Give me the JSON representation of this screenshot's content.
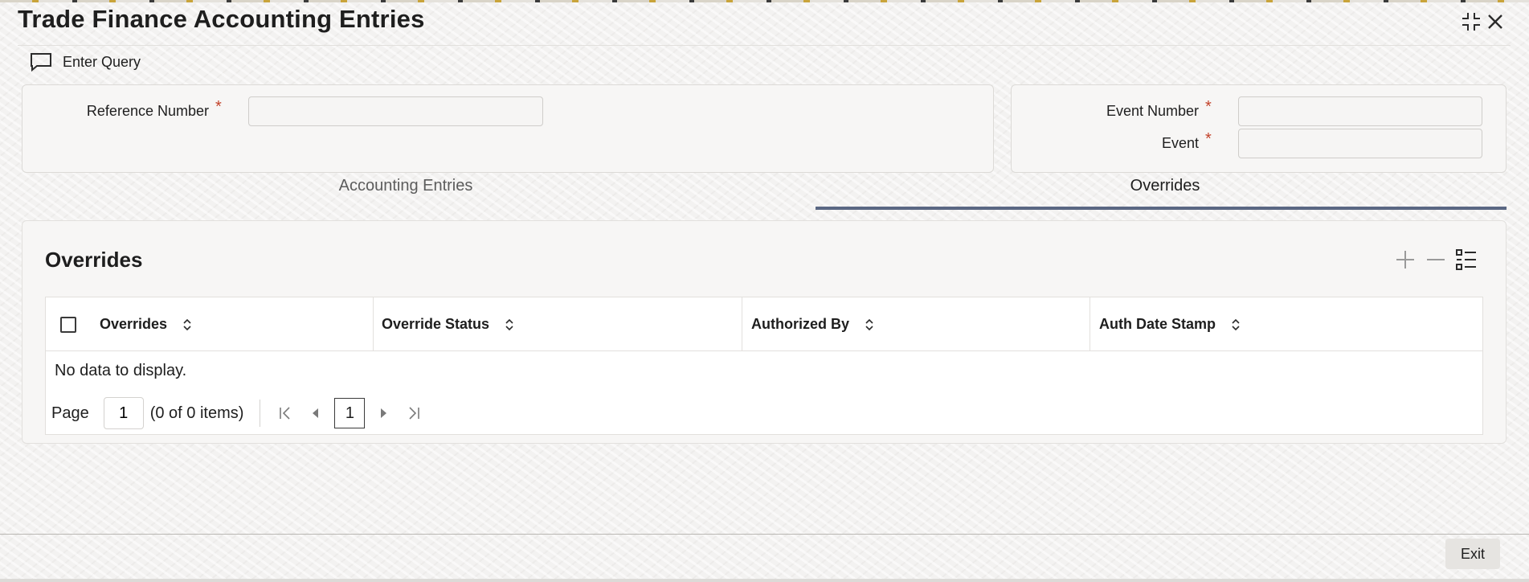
{
  "window": {
    "title": "Trade Finance Accounting Entries",
    "minimize_icon": "collapse-icon",
    "close_icon": "close-icon"
  },
  "toolbar": {
    "enter_query_label": "Enter Query",
    "enter_query_icon": "chat-bubble-icon"
  },
  "form": {
    "reference_number": {
      "label": "Reference Number",
      "required_mark": "*",
      "value": ""
    },
    "event_number": {
      "label": "Event Number",
      "required_mark": "*",
      "value": ""
    },
    "event": {
      "label": "Event",
      "required_mark": "*",
      "value": ""
    }
  },
  "tabs": [
    {
      "label": "Accounting Entries",
      "active": false
    },
    {
      "label": "Overrides",
      "active": true
    }
  ],
  "overrides_section": {
    "title": "Overrides",
    "icons": [
      "add-icon",
      "remove-icon",
      "column-list-icon"
    ],
    "columns": [
      "Overrides",
      "Override Status",
      "Authorized By",
      "Auth Date Stamp"
    ],
    "rows": [],
    "empty_text": "No data to display."
  },
  "pagination": {
    "page_label": "Page",
    "page_value": "1",
    "count_text": "(0 of 0 items)",
    "current_page": "1"
  },
  "footer": {
    "exit_label": "Exit"
  },
  "colors": {
    "accent_tab_underline": "#5a6783",
    "required_asterisk": "#c3432b",
    "background": "#f3f2f1"
  }
}
